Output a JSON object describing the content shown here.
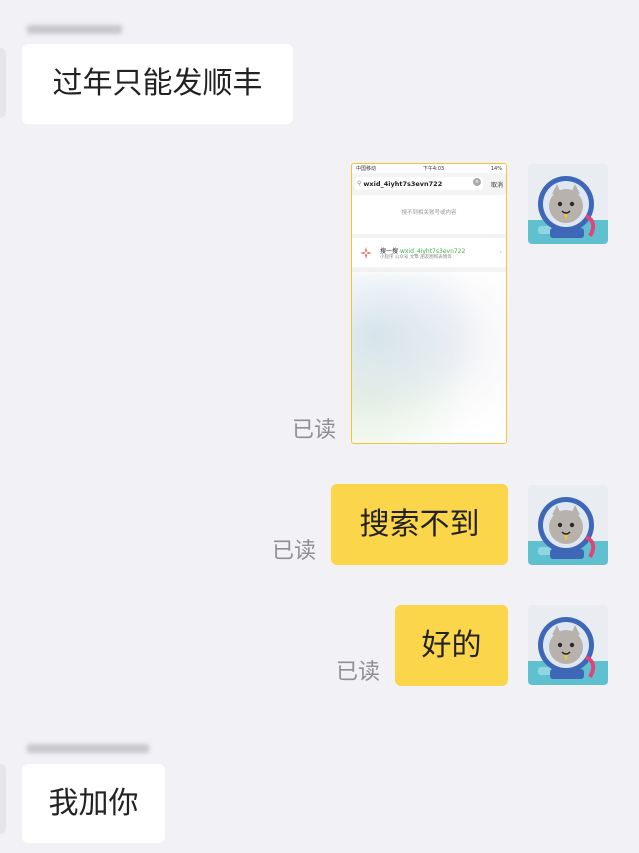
{
  "messages": {
    "m1": {
      "text": "过年只能发顺丰"
    },
    "m2": {
      "read": "已读"
    },
    "m3": {
      "text": "搜索不到",
      "read": "已读"
    },
    "m4": {
      "text": "好的",
      "read": "已读"
    },
    "m5": {
      "text": "我加你"
    }
  },
  "screenshot": {
    "carrier": "中国移动",
    "time": "下午4:03",
    "battery": "14%",
    "search_text": "wxid_4iyht7s3evn722",
    "cancel": "取消",
    "no_result": "搜不到相关账号或内容",
    "result_prefix": "搜一搜",
    "result_query": "wxid_4iyht7s3evn722",
    "result_sub": "小程序  公众号  文章  朋友圈和表情等"
  },
  "colors": {
    "background": "#f1f1f6",
    "incoming_bubble": "#ffffff",
    "outgoing_bubble": "#fcd64a",
    "read_label": "#8e8e93",
    "highlight": "#3fb24b"
  },
  "icons": {
    "avatar": "astronaut-cat-avatar",
    "sogou_logo": "search-one-search-logo"
  }
}
